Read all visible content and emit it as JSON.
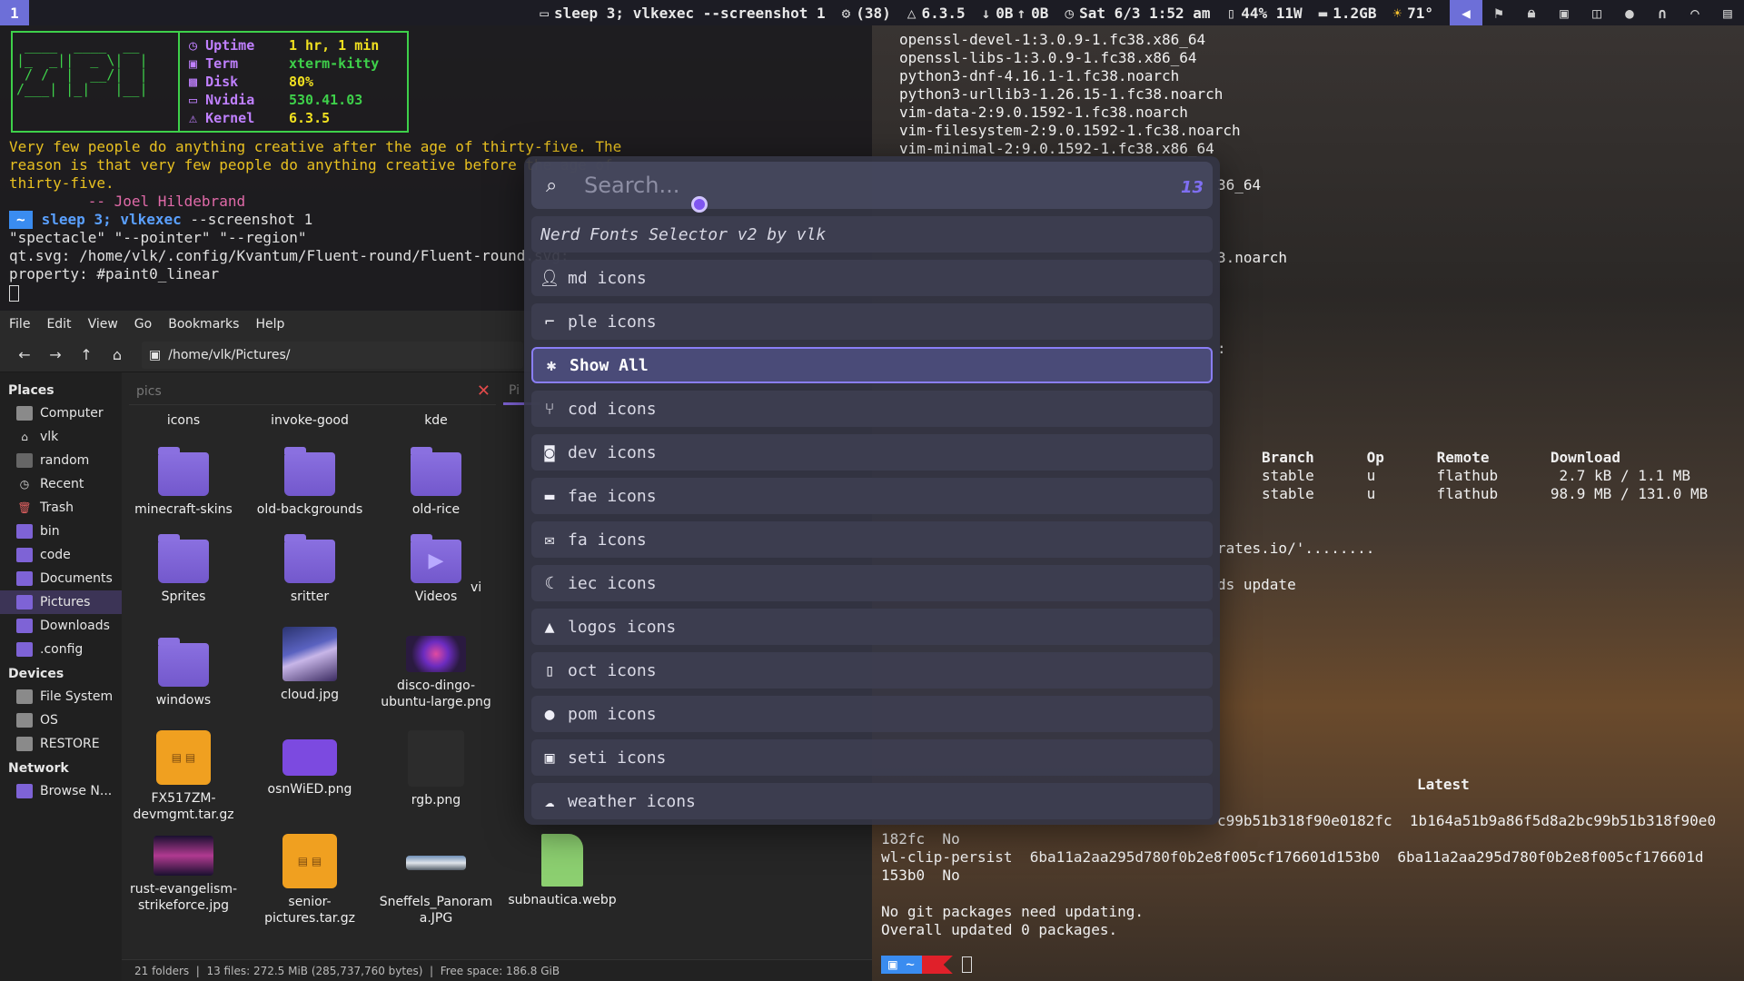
{
  "topbar": {
    "workspace": "1",
    "window_title": "sleep 3; vlkexec --screenshot 1",
    "updates": "(38)",
    "kernel": "6.3.5",
    "net_down": "0B",
    "net_up": "0B",
    "clock": "Sat 6/3 1:52 am",
    "battery": "44% 11W",
    "memory": "1.2GB",
    "weather": "71°"
  },
  "term1": {
    "logo": " ____  ____  __\n|_  _||  _ \\|  |\n / /  |  __/|  |\n/___| |_|   |__|",
    "fetch": [
      {
        "key": "Uptime",
        "value": "1 hr, 1 min"
      },
      {
        "key": "Term",
        "value": "xterm-kitty"
      },
      {
        "key": "Disk",
        "value": "80%"
      },
      {
        "key": "Nvidia",
        "value": "530.41.03"
      },
      {
        "key": "Kernel",
        "value": "6.3.5"
      }
    ],
    "quote_l1": "Very few people do anything creative after the age of thirty-five.  The",
    "quote_l2": "reason is that very few people do anything creative before the age of",
    "quote_l3": "thirty-five.",
    "quote_author": "         -- Joel Hildebrand",
    "prompt_dir": "~",
    "cmd_sleep": "sleep 3;",
    "cmd_exec": "vlkexec",
    "cmd_args": "--screenshot 1",
    "out1": "\"spectacle\" \"--pointer\" \"--region\"",
    "out2": "qt.svg: /home/vlk/.config/Kvantum/Fluent-round/Fluent-round.svg:",
    "out3": "property: #paint0_linear"
  },
  "fm": {
    "menu": [
      "File",
      "Edit",
      "View",
      "Go",
      "Bookmarks",
      "Help"
    ],
    "path": "/home/vlk/Pictures/",
    "filter_placeholder": "pics",
    "tab2": "Pi",
    "places_header": "Places",
    "places": [
      "Computer",
      "vlk",
      "random",
      "Recent",
      "Trash",
      "bin",
      "code",
      "Documents",
      "Pictures",
      "Downloads",
      ".config"
    ],
    "devices_header": "Devices",
    "devices": [
      "File System",
      "OS",
      "RESTORE"
    ],
    "network_header": "Network",
    "network": [
      "Browse N..."
    ],
    "files": {
      "icons": "icons",
      "invoke": "invoke-good",
      "kde": "kde",
      "minecraft": "minecraft-skins",
      "oldbg": "old-backgrounds",
      "oldrice": "old-rice",
      "sprites": "Sprites",
      "sritter": "sritter",
      "videos": "Videos",
      "vi": "vi",
      "windows": "windows",
      "cloud": "cloud.jpg",
      "disco": "disco-dingo-ubuntu-large.png",
      "fx": "FX517ZM-devmgmt.tar.gz",
      "osn": "osnWiED.png",
      "rgb": "rgb.png",
      "rust": "rust-evangelism-strikeforce.jpg",
      "senior": "senior-pictures.tar.gz",
      "sneffels": "Sneffels_Panoram a.JPG",
      "subnautica": "subnautica.webp"
    },
    "status": "21 folders  |  13 files: 272.5 MiB (285,737,760 bytes)  |  Free space: 186.8 GiB"
  },
  "term2": {
    "pkgs": [
      "openssl-devel-1:3.0.9-1.fc38.x86_64",
      "openssl-libs-1:3.0.9-1.fc38.x86_64",
      "python3-dnf-4.16.1-1.fc38.noarch",
      "python3-urllib3-1.26.15-1.fc38.noarch",
      "vim-data-2:9.0.1592-1.fc38.noarch",
      "vim-filesystem-2:9.0.1592-1.fc38.noarch",
      "vim-minimal-2:9.0.1592-1.fc38.x86_64"
    ],
    "frag1": "36_64",
    "frag2": "3.noarch",
    "frag3": ":",
    "flatpak_head": "Branch      Op      Remote       Download",
    "flatpak_r1": "stable      u       flathub       2.7 kB / 1.1 MB",
    "flatpak_r2": "stable      u       flathub      98.9 MB / 131.0 MB",
    "frag4": "rates.io/'........",
    "frag5": "ds update",
    "latest": "Latest",
    "hash_r1": "c99b51b318f90e0182fc  1b164a51b9a86f5d8a2bc99b51b318f90e0",
    "hash_r2": "182fc  No",
    "hash_r3": "wl-clip-persist  6ba11a2aa295d780f0b2e8f005cf176601d153b0  6ba11a2aa295d780f0b2e8f005cf176601d",
    "hash_r4": "153b0  No",
    "msg1": "No git packages need updating.",
    "msg2": "Overall updated 0 packages.",
    "prompt": "~"
  },
  "launcher": {
    "search_placeholder": "Search...",
    "count": "13",
    "subtitle": "Nerd Fonts Selector v2 by vlk",
    "items": [
      {
        "label": "md icons",
        "icon": "person-icon"
      },
      {
        "label": "ple icons",
        "icon": "ple-icon"
      },
      {
        "label": "Show All",
        "icon": "asterisk-icon"
      },
      {
        "label": "cod icons",
        "icon": "git-branch-icon"
      },
      {
        "label": "dev icons",
        "icon": "devicon-icon"
      },
      {
        "label": "fae icons",
        "icon": "bed-icon"
      },
      {
        "label": "fa icons",
        "icon": "envelope-icon"
      },
      {
        "label": "iec icons",
        "icon": "moon-icon"
      },
      {
        "label": "logos icons",
        "icon": "arch-logo-icon"
      },
      {
        "label": "oct icons",
        "icon": "book-icon"
      },
      {
        "label": "pom icons",
        "icon": "tomato-icon"
      },
      {
        "label": "seti icons",
        "icon": "image-icon"
      },
      {
        "label": "weather icons",
        "icon": "weather-fog-icon"
      }
    ],
    "selected": "Show All"
  }
}
